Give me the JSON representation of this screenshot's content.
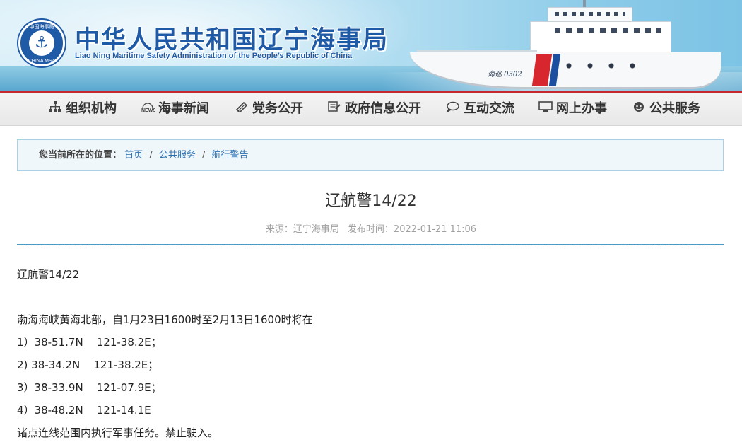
{
  "header": {
    "title": "中华人民共和国辽宁海事局",
    "subtitle": "Liao Ning Maritime Safety Administration of the People’s Republic of China",
    "emblem": {
      "top_text": "中国海事局",
      "bottom_text": "CHINA MSA",
      "icon": "anchor-icon"
    },
    "ship_name": "海巡 0302"
  },
  "nav": {
    "items": [
      {
        "label": "组织机构",
        "icon": "org-chart-icon"
      },
      {
        "label": "海事新闻",
        "icon": "news-icon"
      },
      {
        "label": "党务公开",
        "icon": "pen-icon"
      },
      {
        "label": "政府信息公开",
        "icon": "document-icon"
      },
      {
        "label": "互动交流",
        "icon": "chat-icon"
      },
      {
        "label": "网上办事",
        "icon": "monitor-icon"
      },
      {
        "label": "公共服务",
        "icon": "service-icon"
      }
    ]
  },
  "breadcrumb": {
    "prefix": "您当前所在的位置：",
    "items": [
      "首页",
      "公共服务",
      "航行警告"
    ],
    "separator": "/"
  },
  "article": {
    "title": "辽航警14/22",
    "source": "来源：辽宁海事局",
    "published": "发布时间：2022-01-21 11:06",
    "body": [
      "辽航警14/22",
      "渤海海峡黄海北部，自1月23日1600时至2月13日1600时将在",
      "1）38-51.7N    121-38.2E；",
      "2) 38-34.2N    121-38.2E；",
      "3）38-33.9N    121-07.9E；",
      "4）38-48.2N    121-14.1E",
      "诸点连线范围内执行军事任务。禁止驶入。"
    ]
  },
  "colors": {
    "brand_blue": "#1f5aa6",
    "accent_red": "#c8282c",
    "link_blue": "#2a6fb0",
    "divider_blue": "#4a9cc6"
  }
}
